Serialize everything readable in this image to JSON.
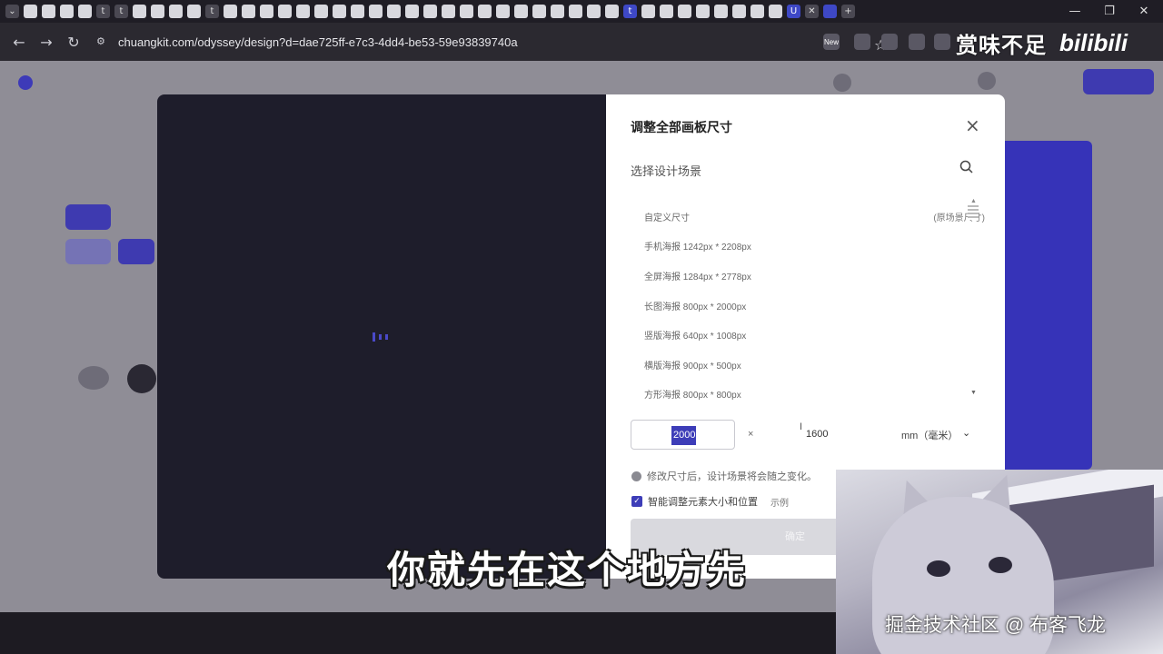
{
  "browser": {
    "url": "chuangkit.com/odyssey/design?d=dae725ff-e7c3-4dd4-be53-59e93839740a",
    "tab_icons": [
      "t",
      "t",
      "t",
      "t",
      "U",
      "知"
    ],
    "new_badge": "New",
    "window_controls": [
      "—",
      "❐",
      "✕"
    ],
    "tab_close": "✕",
    "tab_new": "+"
  },
  "overlay": {
    "top_watermark": "赏味不足",
    "bilibili_logo": "bilibili",
    "subtitle": "你就先在这个地方先",
    "cam_watermark": "掘金技术社区 @ 布客飞龙"
  },
  "modal": {
    "title": "调整全部画板尺寸",
    "scene_label": "选择设计场景",
    "scenes": [
      {
        "label": "自定义尺寸",
        "extra": "(原场景尺寸)"
      },
      {
        "label": "手机海报 1242px * 2208px",
        "extra": ""
      },
      {
        "label": "全屏海报 1284px * 2778px",
        "extra": ""
      },
      {
        "label": "长图海报 800px * 2000px",
        "extra": ""
      },
      {
        "label": "竖版海报 640px * 1008px",
        "extra": ""
      },
      {
        "label": "横版海报 900px * 500px",
        "extra": ""
      },
      {
        "label": "方形海报 800px * 800px",
        "extra": ""
      }
    ],
    "width_value": "2000",
    "times": "×",
    "height_value": "1600",
    "unit": "mm（毫米）",
    "note": "修改尺寸后，设计场景将会随之变化。",
    "smart_resize_label": "智能调整元素大小和位置",
    "smart_resize_extra": "示例",
    "smart_resize_checked": true,
    "confirm_label": "确定"
  },
  "colors": {
    "accent": "#3d3db8",
    "modal_dark": "#1e1d2b",
    "browser_bg": "#2b2930"
  }
}
